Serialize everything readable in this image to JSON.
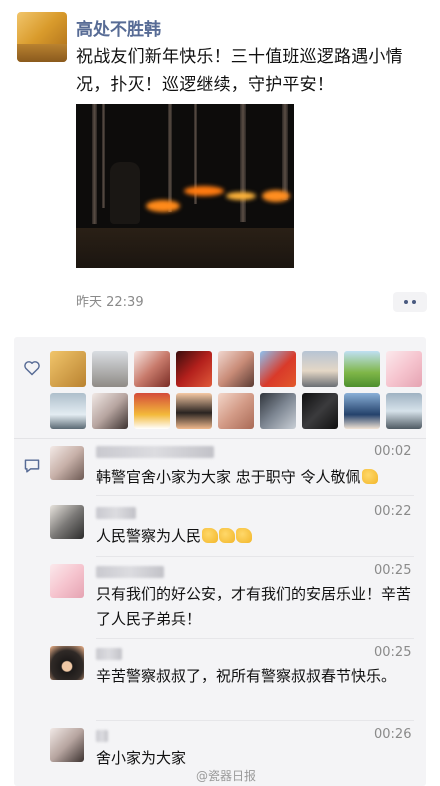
{
  "post": {
    "name": "高处不胜韩",
    "text": "祝战友们新年快乐！三十值班巡逻路遇小情况，扑灭！巡逻继续，守护平安！",
    "time": "昨天 22:39"
  },
  "comments": [
    {
      "time": "00:02",
      "text": "韩警官舍小家为大家 忠于职守 令人敬佩",
      "thumbs": 1
    },
    {
      "time": "00:22",
      "text": "人民警察为人民",
      "thumbs": 3
    },
    {
      "time": "00:25",
      "text": "只有我们的好公安，才有我们的安居乐业！辛苦了人民子弟兵！",
      "thumbs": 0
    },
    {
      "time": "00:25",
      "text": "辛苦警察叔叔了，祝所有警察叔叔春节快乐。",
      "thumbs": 0
    },
    {
      "time": "00:26",
      "text": "舍小家为大家",
      "thumbs": 0
    }
  ],
  "watermark": "@瓷器日报",
  "icons": {
    "like": "heart-outline-icon",
    "comment": "comment-bubble-icon",
    "more": "more-dots-icon",
    "thumb": "thumbs-up-emoji-icon"
  },
  "colors": {
    "name": "#576b95",
    "panel": "#f4f4f6",
    "time": "#8a8a8a"
  }
}
